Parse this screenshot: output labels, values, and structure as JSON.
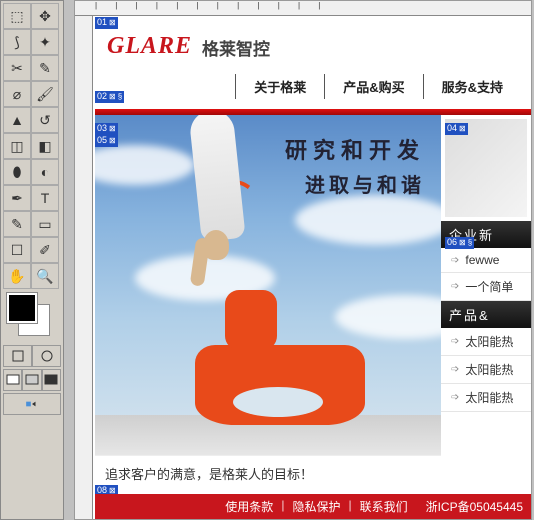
{
  "brand": {
    "en": "GLARE",
    "cn": "格莱智控"
  },
  "nav": {
    "about": "关于格莱",
    "products": "产品&购买",
    "service": "服务&支持"
  },
  "hero": {
    "line1": "研究和开发",
    "line2": "进取与和谐",
    "caption": "追求客户的满意，是格莱人的目标！"
  },
  "side": {
    "news_head": "企业新",
    "news": [
      "fewwe",
      "一个简单"
    ],
    "prod_head": "产品&",
    "prods": [
      "太阳能热",
      "太阳能热",
      "太阳能热"
    ]
  },
  "footer": {
    "terms": "使用条款",
    "privacy": "隐私保护",
    "contact": "联系我们",
    "icp": "浙ICP备05045445"
  },
  "slices": {
    "s01": "01",
    "s02": "02",
    "s03": "03",
    "s04": "04",
    "s05": "05",
    "s06": "06",
    "s08": "08"
  }
}
